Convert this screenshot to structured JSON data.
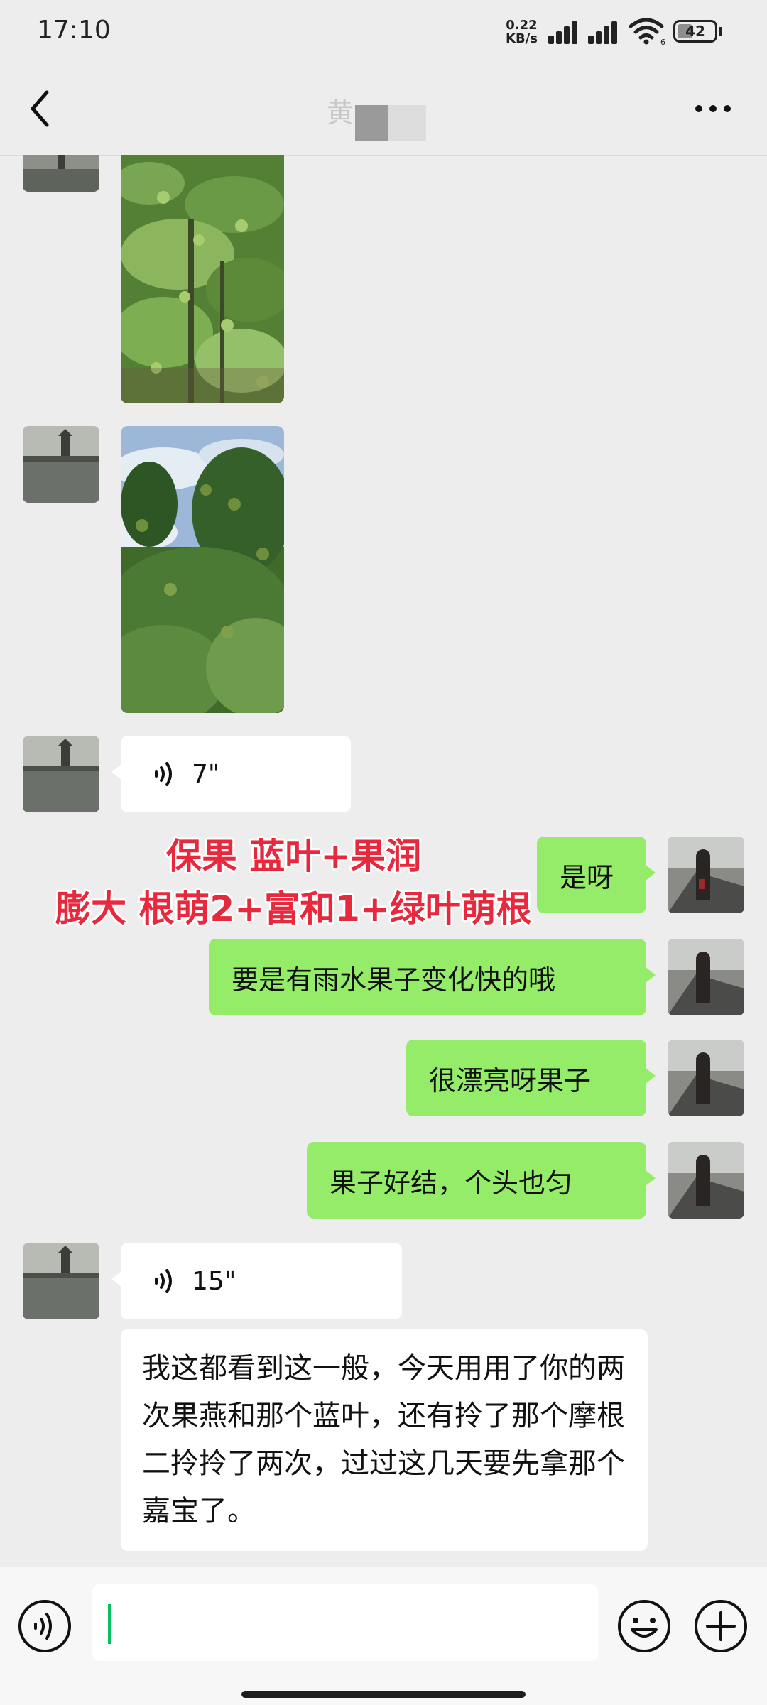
{
  "status_bar": {
    "time": "17:10",
    "net_speed_value": "0.22",
    "net_speed_unit": "KB/s",
    "wifi_label": "6",
    "battery_level": "42",
    "battery_fraction": 0.42
  },
  "header": {
    "title": "黄",
    "back_icon": "chevron-left-icon",
    "more_icon": "ellipsis-icon"
  },
  "messages": [
    {
      "side": "in",
      "type": "image",
      "content": "citrus trees with green fruit"
    },
    {
      "side": "in",
      "type": "image",
      "content": "citrus tree branches against blue sky"
    },
    {
      "side": "in",
      "type": "voice",
      "duration": "7\""
    },
    {
      "side": "out",
      "type": "text",
      "text": "是呀"
    },
    {
      "side": "out",
      "type": "text",
      "text": "要是有雨水果子变化快的哦"
    },
    {
      "side": "out",
      "type": "text",
      "text": "很漂亮呀果子"
    },
    {
      "side": "out",
      "type": "text",
      "text": "果子好结，个头也匀"
    },
    {
      "side": "in",
      "type": "voice",
      "duration": "15\""
    },
    {
      "side": "in",
      "type": "text",
      "text": "我这都看到这一般，今天用用了你的两次果燕和那个蓝叶，还有拎了那个摩根二拎拎了两次，过过这几天要先拿那个嘉宝了。"
    }
  ],
  "annotation": {
    "line1": "保果 蓝叶+果润",
    "line2": "膨大 根萌2+富和1+绿叶萌根",
    "color": "#e8283c"
  },
  "input_bar": {
    "value": "",
    "voice_icon": "voice-toggle-icon",
    "emoji_icon": "emoji-icon",
    "plus_icon": "plus-icon"
  },
  "colors": {
    "background": "#ededed",
    "incoming_bubble": "#ffffff",
    "outgoing_bubble": "#95ec69",
    "cursor": "#07c160"
  }
}
